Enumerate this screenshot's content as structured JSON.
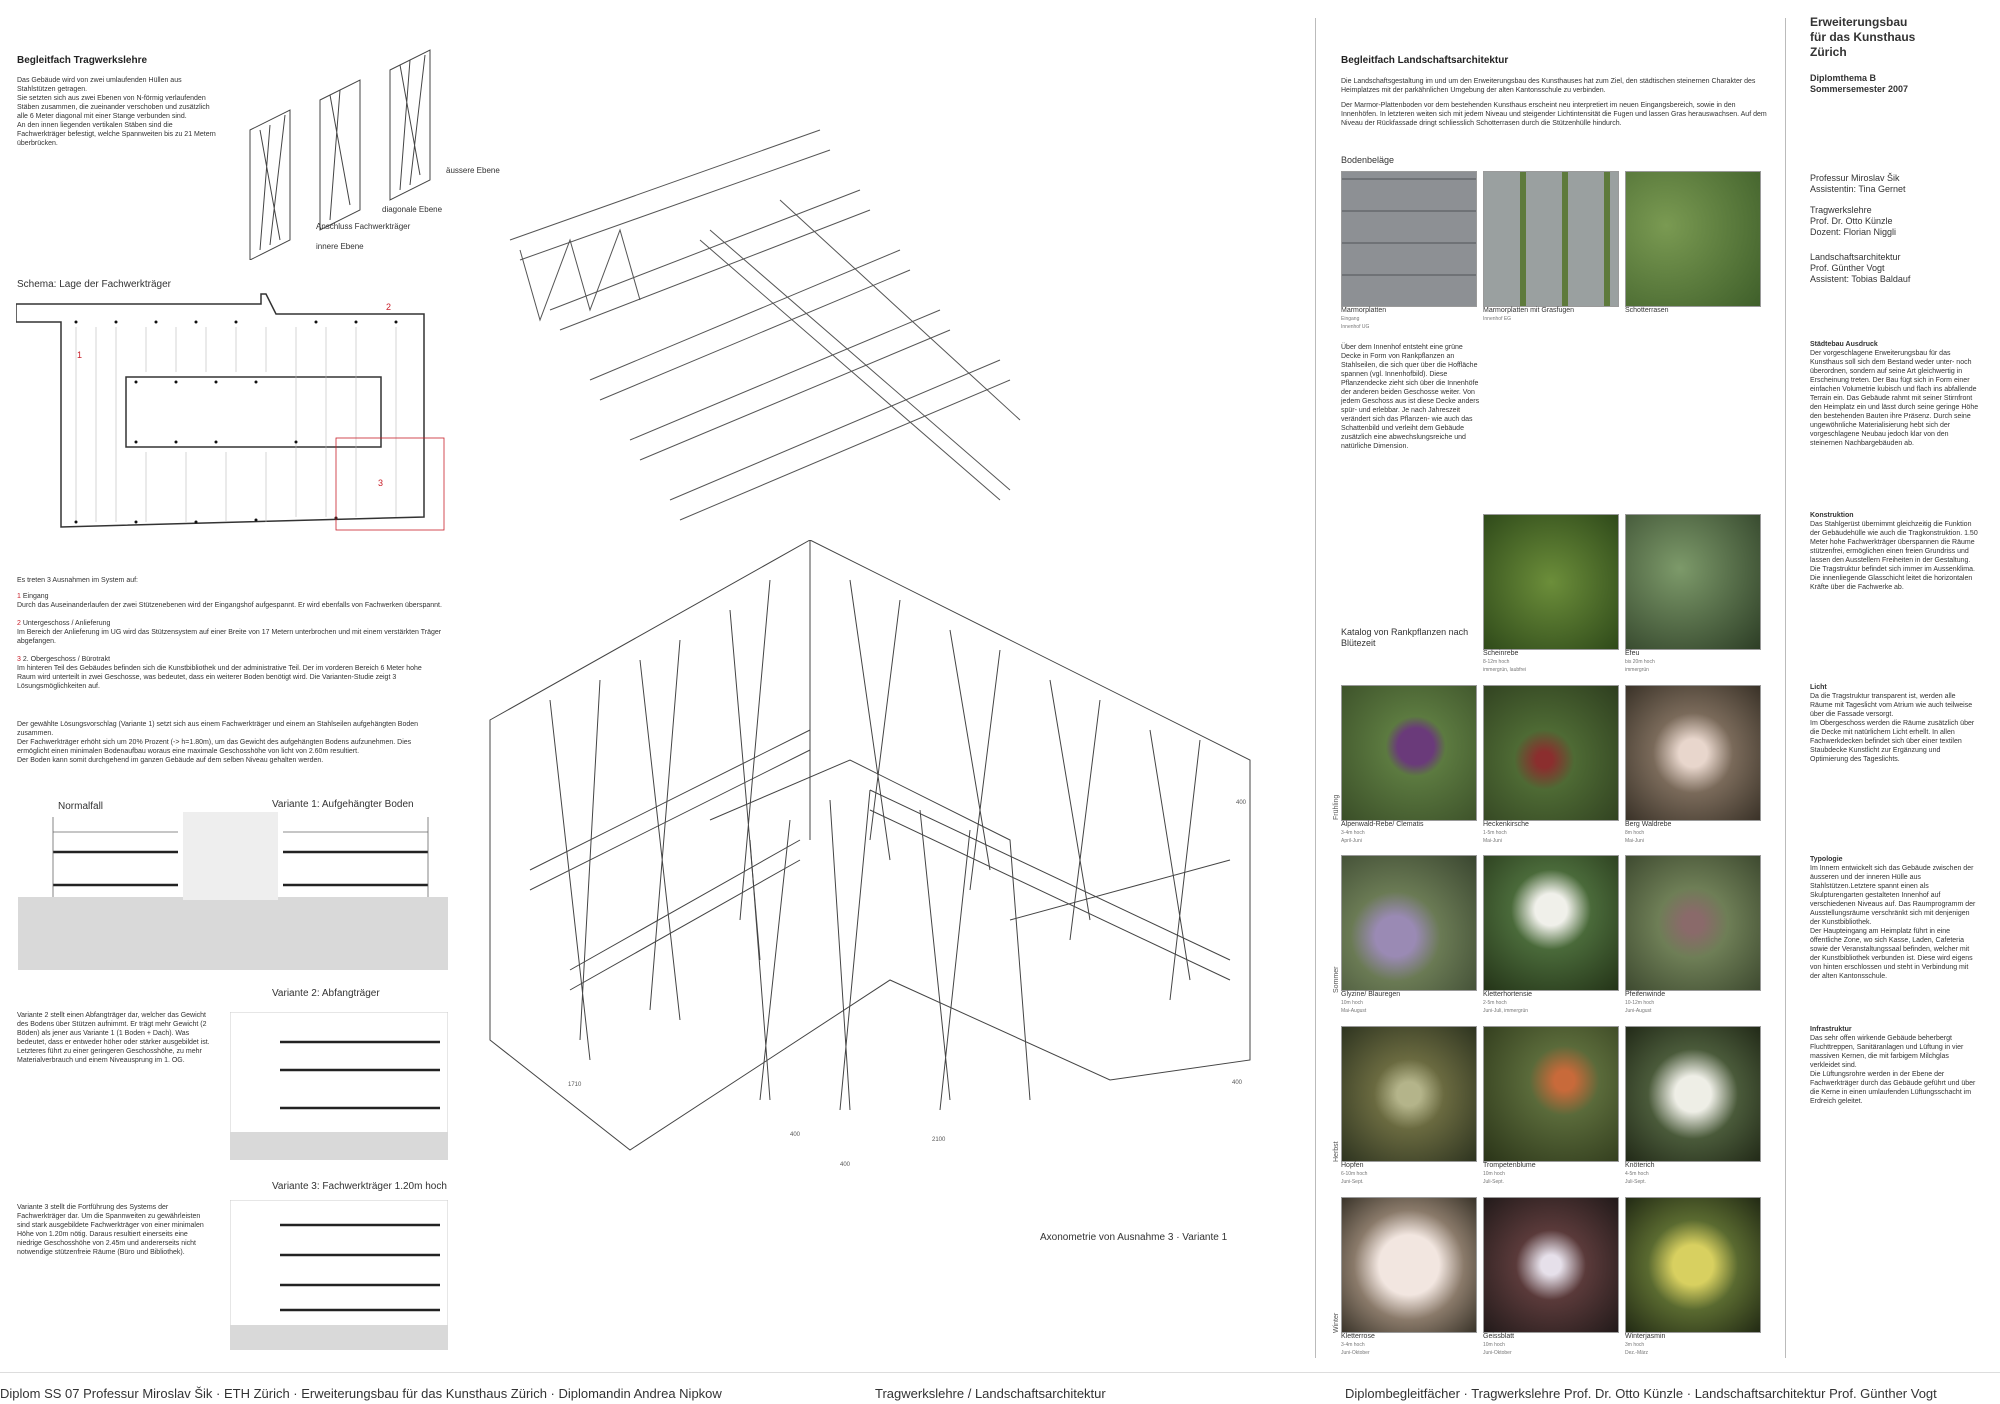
{
  "left": {
    "title": "Begleitfach Tragwerkslehre",
    "intro": "Das Gebäude wird von zwei umlaufenden Hüllen aus Stahlstützen getragen.\nSie setzten sich aus zwei Ebenen von N-förmig verlaufenden Stäben zusammen, die zueinander verschoben und zusätzlich alle 6 Meter diagonal mit einer Stange verbunden sind.\nAn den innen liegenden vertikalen Stäben sind die Fachwerkträger befestigt, welche Spannweiten bis zu 21 Metern überbrücken.",
    "diagram_labels": [
      "äussere Ebene",
      "diagonale Ebene",
      "Anschluss Fachwerkträger",
      "innere Ebene"
    ],
    "schema_title": "Schema: Lage der Fachwerkträger",
    "schema_marks": [
      "1",
      "2",
      "3"
    ],
    "exceptions_intro": "Es treten 3 Ausnahmen im System auf:",
    "exceptions": [
      {
        "num": "1",
        "title": "Eingang",
        "text": "Durch das Auseinanderlaufen der zwei Stützenebenen wird der Eingangshof aufgespannt. Er wird ebenfalls von Fachwerken überspannt."
      },
      {
        "num": "2",
        "title": "Untergeschoss / Anlieferung",
        "text": "Im Bereich der Anlieferung im UG wird das Stützensystem auf einer Breite von 17 Metern unterbrochen und mit einem verstärkten Träger abgefangen."
      },
      {
        "num": "3",
        "title": "2. Obergeschoss / Bürotrakt",
        "text": "Im hinteren Teil des Gebäudes befinden sich die Kunstbibliothek und der administrative Teil. Der im vorderen Bereich 6 Meter hohe Raum wird unterteilt in zwei Geschosse, was bedeutet, dass ein weiterer Boden benötigt wird. Die Varianten-Studie zeigt 3 Lösungsmöglichkeiten auf."
      }
    ],
    "solution": "Der gewählte Lösungsvorschlag (Variante 1) setzt sich aus einem Fachwerkträger und einem an Stahlseilen aufgehängten Boden zusammen.\nDer Fachwerkträger erhöht sich um 20% Prozent (-> h=1.80m), um das Gewicht des aufgehängten Bodens aufzunehmen. Dies ermöglicht einen minimalen Bodenaufbau woraus eine maximale Geschosshöhe von licht von 2.60m resultiert.\nDer Boden kann somit durchgehend im ganzen Gebäude auf dem selben Niveau gehalten werden.",
    "normalfall": "Normalfall",
    "variante1": "Variante 1: Aufgehängter Boden",
    "variante2": "Variante 2: Abfangträger",
    "variante2_text": "Variante 2 stellt einen Abfangträger dar, welcher das Gewicht des Bodens über Stützen aufnimmt. Er trägt mehr Gewicht (2 Böden) als jener aus Variante 1 (1 Boden + Dach). Was bedeutet, dass er entweder höher oder stärker ausgebildet ist. Letzteres führt zu einer geringeren Geschosshöhe, zu mehr Materialverbrauch und einem Niveausprung im 1. OG.",
    "variante3": "Variante 3: Fachwerkträger 1.20m hoch",
    "variante3_text": "Variante 3 stellt die Fortführung des Systems der Fachwerkträger dar. Um die Spannweiten zu gewährleisten sind stark ausgebildete Fachwerkträger von einer minimalen Höhe von 1.20m nötig. Daraus resultiert einerseits eine niedrige Geschosshöhe von 2.45m und andererseits nicht notwendige stützenfreie Räume (Büro und Bibliothek)."
  },
  "center": {
    "axon_caption": "Axonometrie von Ausnahme 3 · Variante 1",
    "dims": [
      "1710",
      "2100",
      "400",
      "400",
      "400",
      "400"
    ]
  },
  "land": {
    "title": "Begleitfach Landschaftsarchitektur",
    "intro1": "Die Landschaftsgestaltung im und um den Erweiterungsbau des Kunsthauses hat zum Ziel, den städtischen steinernen Charakter des Heimplatzes mit der parkähnlichen Umgebung der alten Kantonsschule zu verbinden.",
    "intro2": "Der Marmor-Plattenboden vor dem bestehenden Kunsthaus erscheint neu interpretiert im neuen Eingangsbereich, sowie in den Innenhöfen. In letzteren weiten sich mit jedem Niveau und steigender Lichtintensität die Fugen und lassen Gras herauswachsen. Auf dem Niveau der Rückfassade dringt schliesslich Schotterrasen durch die Stützenhülle hindurch.",
    "boden_title": "Bodenbeläge",
    "boden": [
      {
        "name": "Marmorplatten",
        "sub": "Eingang\nInnenhof UG"
      },
      {
        "name": "Marmorplatten mit Grasfugen",
        "sub": "Innenhof EG"
      },
      {
        "name": "Schotterrasen",
        "sub": ""
      }
    ],
    "innenhof_text": "Über dem Innenhof entsteht eine grüne Decke in Form von Rankpflanzen an Stahlseilen, die sich quer über die Hoffläche spannen (vgl. Innenhofbild). Diese Pflanzendecke zieht sich über die Innenhöfe der anderen beiden Geschosse weiter. Von jedem Geschoss aus ist diese Decke anders spür- und erlebbar. Je nach Jahreszeit verändert sich das Pflanzen- wie auch das Schattenbild und verleiht dem Gebäude zusätzlich eine abwechslungsreiche und natürliche Dimension.",
    "katalog_title": "Katalog von Rankpflanzen nach Blütezeit",
    "seasons": [
      "Frühling",
      "Sommer",
      "Herbst",
      "Winter"
    ],
    "plants_top": [
      {
        "name": "Scheinrebe",
        "sub": "8-12m hoch\nimmergrün, laubfrei"
      },
      {
        "name": "Efeu",
        "sub": "bis 20m hoch\nimmergrün"
      }
    ],
    "plants": [
      [
        {
          "name": "Alpenwald-Rebe/ Clematis",
          "sub": "3-4m hoch\nApril-Juni"
        },
        {
          "name": "Heckenkirsche",
          "sub": "1-5m hoch\nMai-Juni"
        },
        {
          "name": "Berg Waldrebe",
          "sub": "8m hoch\nMai-Juni"
        }
      ],
      [
        {
          "name": "Glyzine/ Blauregen",
          "sub": "10m hoch\nMai-August"
        },
        {
          "name": "Kletterhortensie",
          "sub": "2-5m hoch\nJuni-Juli, immergrün"
        },
        {
          "name": "Pfeifenwinde",
          "sub": "10-12m hoch\nJuni-August"
        }
      ],
      [
        {
          "name": "Hopfen",
          "sub": "6-10m hoch\nJuni-Sept."
        },
        {
          "name": "Trompetenblume",
          "sub": "10m hoch\nJuli-Sept."
        },
        {
          "name": "Knöterich",
          "sub": "4-5m hoch\nJuli-Sept."
        }
      ],
      [
        {
          "name": "Kletterrose",
          "sub": "3-4m hoch\nJuni-Oktober"
        },
        {
          "name": "Geissblatt",
          "sub": "10m hoch\nJuni-Oktober"
        },
        {
          "name": "Winterjasmin",
          "sub": "3m hoch\nDez.-März"
        }
      ]
    ]
  },
  "right": {
    "title": "Erweiterungsbau\nfür das Kunsthaus\nZürich",
    "subtitle": "Diplomthema B\nSommersemester 2007",
    "credits1": "Professur Miroslav Šik\nAssistentin: Tina Gernet",
    "credits2": "Tragwerkslehre\nProf. Dr. Otto Künzle\nDozent: Florian Niggli",
    "credits3": "Landschaftsarchitektur\nProf. Günther Vogt\nAssistent: Tobias Baldauf",
    "sections": [
      {
        "title": "Städtebau Ausdruck",
        "text": "Der vorgeschlagene Erweiterungsbau für das Kunsthaus soll sich dem Bestand weder unter- noch überordnen, sondern auf seine Art gleichwertig in Erscheinung treten. Der Bau fügt sich in Form einer einfachen Volumetrie kubisch und flach ins abfallende Terrain ein. Das Gebäude rahmt mit seiner Stirnfront den Heimplatz ein und lässt durch seine geringe Höhe den bestehenden Bauten ihre Präsenz. Durch seine ungewöhnliche Materialisierung hebt sich der vorgeschlagene Neubau jedoch klar von den steinernen Nachbargebäuden ab."
      },
      {
        "title": "Konstruktion",
        "text": "Das Stahlgerüst übernimmt gleichzeitig die Funktion der Gebäudehülle wie auch die Tragkonstruktion. 1.50 Meter hohe Fachwerkträger überspannen die Räume stützenfrei, ermöglichen einen freien Grundriss und lassen den Ausstellern Freiheiten in der Gestaltung. Die Tragstruktur befindet sich immer im Aussenklima. Die innenliegende Glasschicht leitet die horizontalen Kräfte über die Fachwerke ab."
      },
      {
        "title": "Licht",
        "text": "Da die Tragstruktur transparent ist, werden alle Räume mit Tageslicht vom Atrium wie auch teilweise über die Fassade versorgt.\nIm Obergeschoss werden die Räume zusätzlich über die Decke mit natürlichem Licht erhellt. In allen Fachwerkdecken befindet sich über einer textilen Staubdecke Kunstlicht zur Ergänzung und Optimierung des Tageslichts."
      },
      {
        "title": "Typologie",
        "text": "Im Innern entwickelt sich das Gebäude zwischen der äusseren und der inneren Hülle aus Stahlstützen.Letztere spannt einen als Skulpturengarten gestalteten Innenhof auf verschiedenen Niveaus auf. Das Raumprogramm der Ausstellungsräume verschränkt sich mit denjenigen der Kunstbibliothek.\nDer Haupteingang am Heimplatz führt in eine öffentliche Zone, wo sich Kasse, Laden, Cafeteria sowie der Veranstaltungssaal befinden, welcher mit der Kunstbibliothek verbunden ist. Diese wird eigens von hinten erschlossen und steht in Verbindung mit der alten Kantonsschule."
      },
      {
        "title": "Infrastruktur",
        "text": "Das sehr offen wirkende Gebäude beherbergt Fluchttreppen, Sanitäranlagen und Lüftung in vier massiven Kernen, die mit farbigem Milchglas verkleidet sind.\nDie Lüftungsrohre werden in der Ebene der Fachwerkträger durch das Gebäude geführt und über die Kerne in einen umlaufenden Lüftungsschacht im Erdreich geleitet."
      }
    ]
  },
  "footer": {
    "left": "Diplom SS 07 Professur Miroslav Šik · ETH Zürich · Erweiterungsbau für das Kunsthaus Zürich · Diplomandin Andrea Nipkow",
    "center": "Tragwerkslehre / Landschaftsarchitektur",
    "right": "Diplombegleitfächer · Tragwerkslehre Prof. Dr. Otto Künzle · Landschaftsarchitektur Prof. Günther Vogt"
  },
  "colors": {
    "accent_red": "#c8202a",
    "photo_stone": "#8d9094",
    "photo_green": "#5e7a3c"
  }
}
